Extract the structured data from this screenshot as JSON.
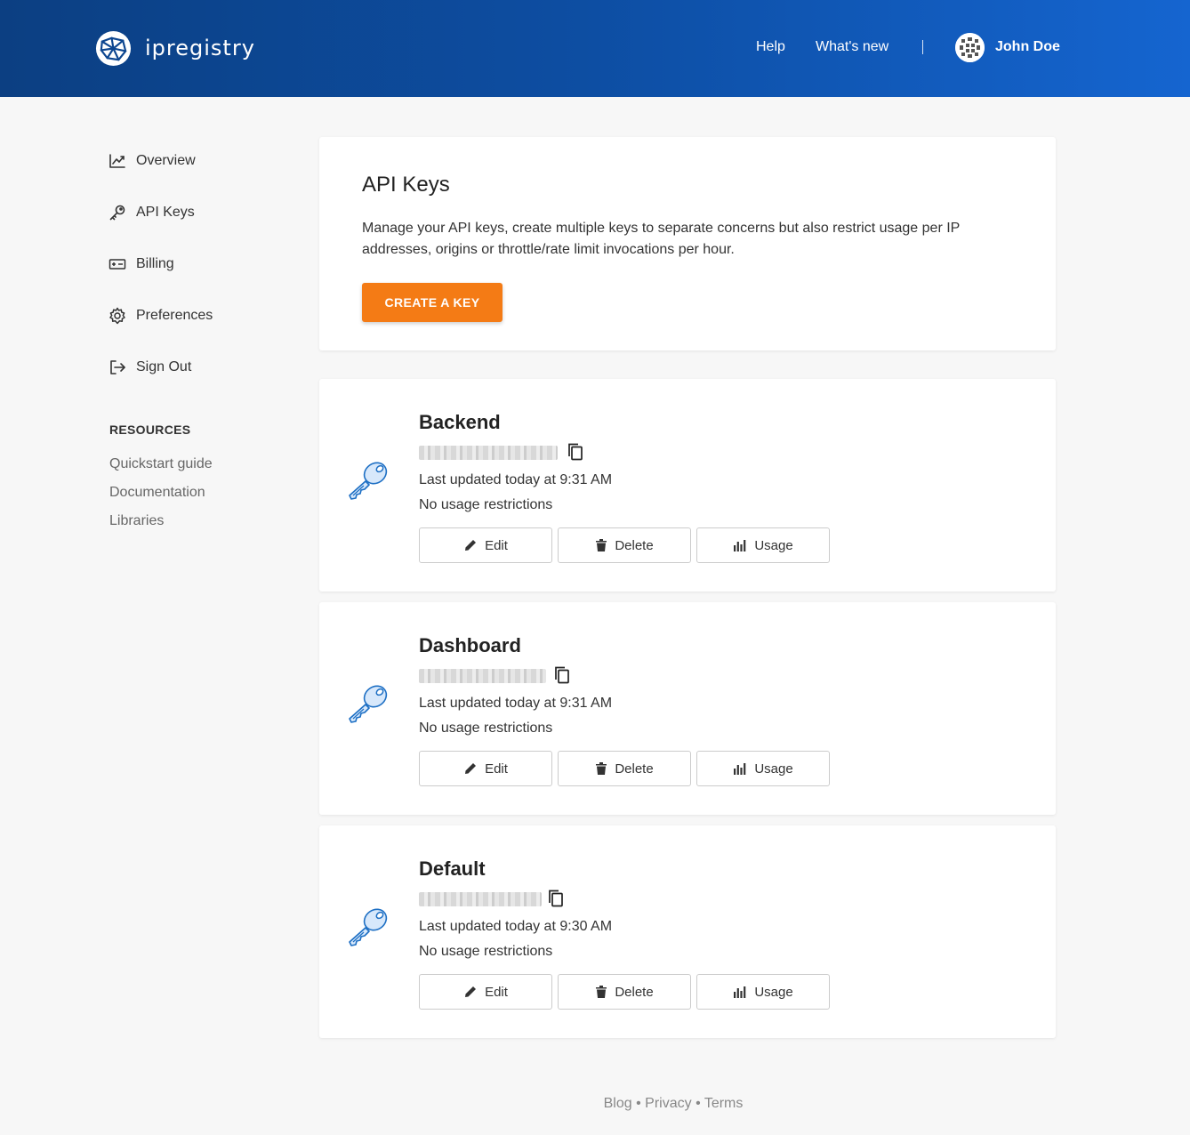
{
  "header": {
    "brand": "ipregistry",
    "nav": {
      "help": "Help",
      "whats_new": "What's new"
    },
    "user_name": "John Doe",
    "colors": {
      "gradient_start": "#0c3f82",
      "gradient_end": "#1565d0"
    }
  },
  "sidebar": {
    "items": [
      {
        "label": "Overview",
        "icon": "chart-line-icon"
      },
      {
        "label": "API Keys",
        "icon": "key-icon"
      },
      {
        "label": "Billing",
        "icon": "billing-icon"
      },
      {
        "label": "Preferences",
        "icon": "gear-icon"
      },
      {
        "label": "Sign Out",
        "icon": "sign-out-icon"
      }
    ],
    "resources_title": "RESOURCES",
    "resources": [
      "Quickstart guide",
      "Documentation",
      "Libraries"
    ]
  },
  "intro": {
    "title": "API Keys",
    "description": "Manage your API keys, create multiple keys to separate concerns but also restrict usage per IP addresses, origins or throttle/rate limit invocations per hour.",
    "create_button": "CREATE A KEY",
    "accent_color": "#f47b15"
  },
  "keys": [
    {
      "name": "Backend",
      "updated": "Last updated today at 9:31 AM",
      "restrictions": "No usage restrictions"
    },
    {
      "name": "Dashboard",
      "updated": "Last updated today at 9:31 AM",
      "restrictions": "No usage restrictions"
    },
    {
      "name": "Default",
      "updated": "Last updated today at 9:30 AM",
      "restrictions": "No usage restrictions"
    }
  ],
  "key_actions": {
    "edit": "Edit",
    "delete": "Delete",
    "usage": "Usage"
  },
  "footer": {
    "blog": "Blog",
    "privacy": "Privacy",
    "terms": "Terms",
    "separator": "•"
  }
}
